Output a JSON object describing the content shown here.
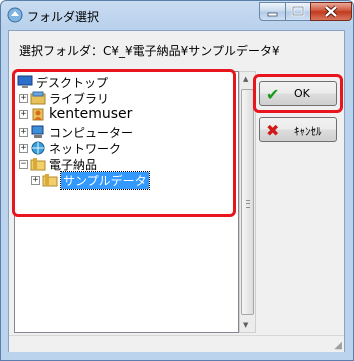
{
  "window": {
    "title": "フォルダ選択"
  },
  "path": {
    "label": "選択フォルダ：",
    "value": "C¥_¥電子納品¥サンプルデータ¥"
  },
  "tree": {
    "items": [
      {
        "label": "デスクトップ",
        "icon": "desktop-icon",
        "expander": ""
      },
      {
        "label": "ライブラリ",
        "icon": "library-icon",
        "expander": "+"
      },
      {
        "label": "kentemuser",
        "icon": "user-icon",
        "expander": "+"
      },
      {
        "label": "コンピューター",
        "icon": "computer-icon",
        "expander": "+"
      },
      {
        "label": "ネットワーク",
        "icon": "network-icon",
        "expander": "+"
      },
      {
        "label": "電子納品",
        "icon": "folder-icon",
        "expander": "−"
      },
      {
        "label": "サンプルデータ",
        "icon": "folder-icon",
        "expander": "+",
        "selected": true
      }
    ]
  },
  "buttons": {
    "ok": "OK",
    "cancel": "ｷｬﾝｾﾙ"
  },
  "colors": {
    "highlight": "#e8141e",
    "selection": "#3399ff",
    "ok_check": "#1a9a1a",
    "cancel_x": "#d01818"
  }
}
